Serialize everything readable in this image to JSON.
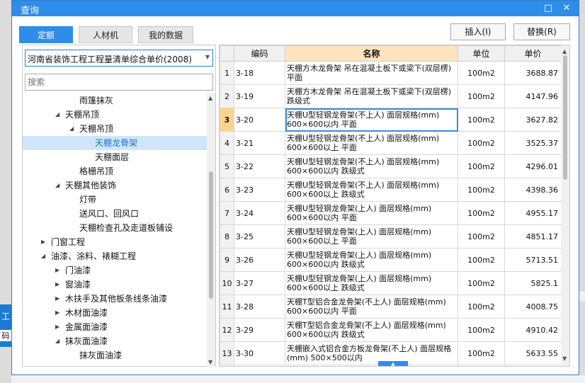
{
  "window": {
    "title": "查询",
    "maximize_glyph": "□",
    "close_glyph": "✕"
  },
  "tabs": [
    {
      "label": "定额",
      "active": true
    },
    {
      "label": "人材机",
      "active": false
    },
    {
      "label": "我的数据",
      "active": false
    }
  ],
  "actions": {
    "insert_label": "插入(I)",
    "replace_label": "替换(R)"
  },
  "library": {
    "selected": "河南省装饰工程工程量清单综合单价(2008)"
  },
  "search": {
    "placeholder": "搜索"
  },
  "tree": [
    {
      "label": "雨篷抹灰",
      "level": 3,
      "caret": ""
    },
    {
      "label": "天棚吊顶",
      "level": 2,
      "caret": "◢"
    },
    {
      "label": "天棚吊顶",
      "level": 3,
      "caret": "◢"
    },
    {
      "label": "天棚龙骨架",
      "level": 4,
      "caret": "",
      "selected": true
    },
    {
      "label": "天棚面层",
      "level": 4,
      "caret": ""
    },
    {
      "label": "格栅吊顶",
      "level": 3,
      "caret": ""
    },
    {
      "label": "天棚其他装饰",
      "level": 2,
      "caret": "◢"
    },
    {
      "label": "灯带",
      "level": 3,
      "caret": ""
    },
    {
      "label": "送风口、回风口",
      "level": 3,
      "caret": ""
    },
    {
      "label": "天棚检查孔及走道板铺设",
      "level": 3,
      "caret": ""
    },
    {
      "label": "门窗工程",
      "level": 1,
      "caret": "▶"
    },
    {
      "label": "油漆、涂料、裱糊工程",
      "level": 1,
      "caret": "◢"
    },
    {
      "label": "门油漆",
      "level": 2,
      "caret": "▶"
    },
    {
      "label": "窗油漆",
      "level": 2,
      "caret": "▶"
    },
    {
      "label": "木扶手及其他板条线条油漆",
      "level": 2,
      "caret": "▶"
    },
    {
      "label": "木材面油漆",
      "level": 2,
      "caret": "▶"
    },
    {
      "label": "金属面油漆",
      "level": 2,
      "caret": "▶"
    },
    {
      "label": "抹灰面油漆",
      "level": 2,
      "caret": "◢"
    },
    {
      "label": "抹灰面油漆",
      "level": 3,
      "caret": ""
    }
  ],
  "grid": {
    "headers": {
      "code": "编码",
      "name": "名称",
      "unit": "单位",
      "price": "单价"
    },
    "rows": [
      {
        "idx": "1",
        "code": "3-18",
        "name": "天棚方木龙骨架 吊在混凝土板下或梁下(双层楞) 平面",
        "unit": "100m2",
        "price": "3688.87"
      },
      {
        "idx": "2",
        "code": "3-19",
        "name": "天棚方木龙骨架 吊在混凝土板下或梁下(双层楞) 跌级式",
        "unit": "100m2",
        "price": "4147.96"
      },
      {
        "idx": "3",
        "code": "3-20",
        "name": "天棚U型轻钢龙骨架(不上人) 面层规格(mm) 600×600以内 平面",
        "unit": "100m2",
        "price": "3627.82",
        "current": true
      },
      {
        "idx": "4",
        "code": "3-21",
        "name": "天棚U型轻钢龙骨架(不上人) 面层规格(mm) 600×600以上 平面",
        "unit": "100m2",
        "price": "3525.37"
      },
      {
        "idx": "5",
        "code": "3-22",
        "name": "天棚U型轻钢龙骨架(不上人) 面层规格(mm) 600×600以内 跌级式",
        "unit": "100m2",
        "price": "4296.01"
      },
      {
        "idx": "6",
        "code": "3-23",
        "name": "天棚U型轻钢龙骨架(不上人) 面层规格(mm) 600×600以上 跌级式",
        "unit": "100m2",
        "price": "4398.36"
      },
      {
        "idx": "7",
        "code": "3-24",
        "name": "天棚U型轻钢龙骨架(上人) 面层规格(mm) 600×600以内 平面",
        "unit": "100m2",
        "price": "4955.17"
      },
      {
        "idx": "8",
        "code": "3-25",
        "name": "天棚U型轻钢龙骨架(上人) 面层规格(mm) 600×600以上 平面",
        "unit": "100m2",
        "price": "4851.17"
      },
      {
        "idx": "9",
        "code": "3-26",
        "name": "天棚U型轻钢龙骨架(上人) 面层规格(mm) 600×600以内 跌级式",
        "unit": "100m2",
        "price": "5713.51"
      },
      {
        "idx": "10",
        "code": "3-27",
        "name": "天棚U型轻钢龙骨架(上人) 面层规格(mm) 600×600以上 跌级式",
        "unit": "100m2",
        "price": "5825.1"
      },
      {
        "idx": "11",
        "code": "3-28",
        "name": "天棚T型铝合金龙骨架(不上人) 面层规格(mm) 600×600以内 平面",
        "unit": "100m2",
        "price": "4008.75"
      },
      {
        "idx": "12",
        "code": "3-29",
        "name": "天棚T型铝合金龙骨架(不上人) 面层规格(mm) 600×600以内 跌级式",
        "unit": "100m2",
        "price": "4910.42"
      },
      {
        "idx": "13",
        "code": "3-30",
        "name": "天棚嵌入式铝合金方板龙骨架(不上人) 面层规格(mm) 500×500以内",
        "unit": "100m2",
        "price": "5633.55"
      }
    ]
  },
  "background": {
    "tab_glyph": "工",
    "code_glyph": "码"
  }
}
